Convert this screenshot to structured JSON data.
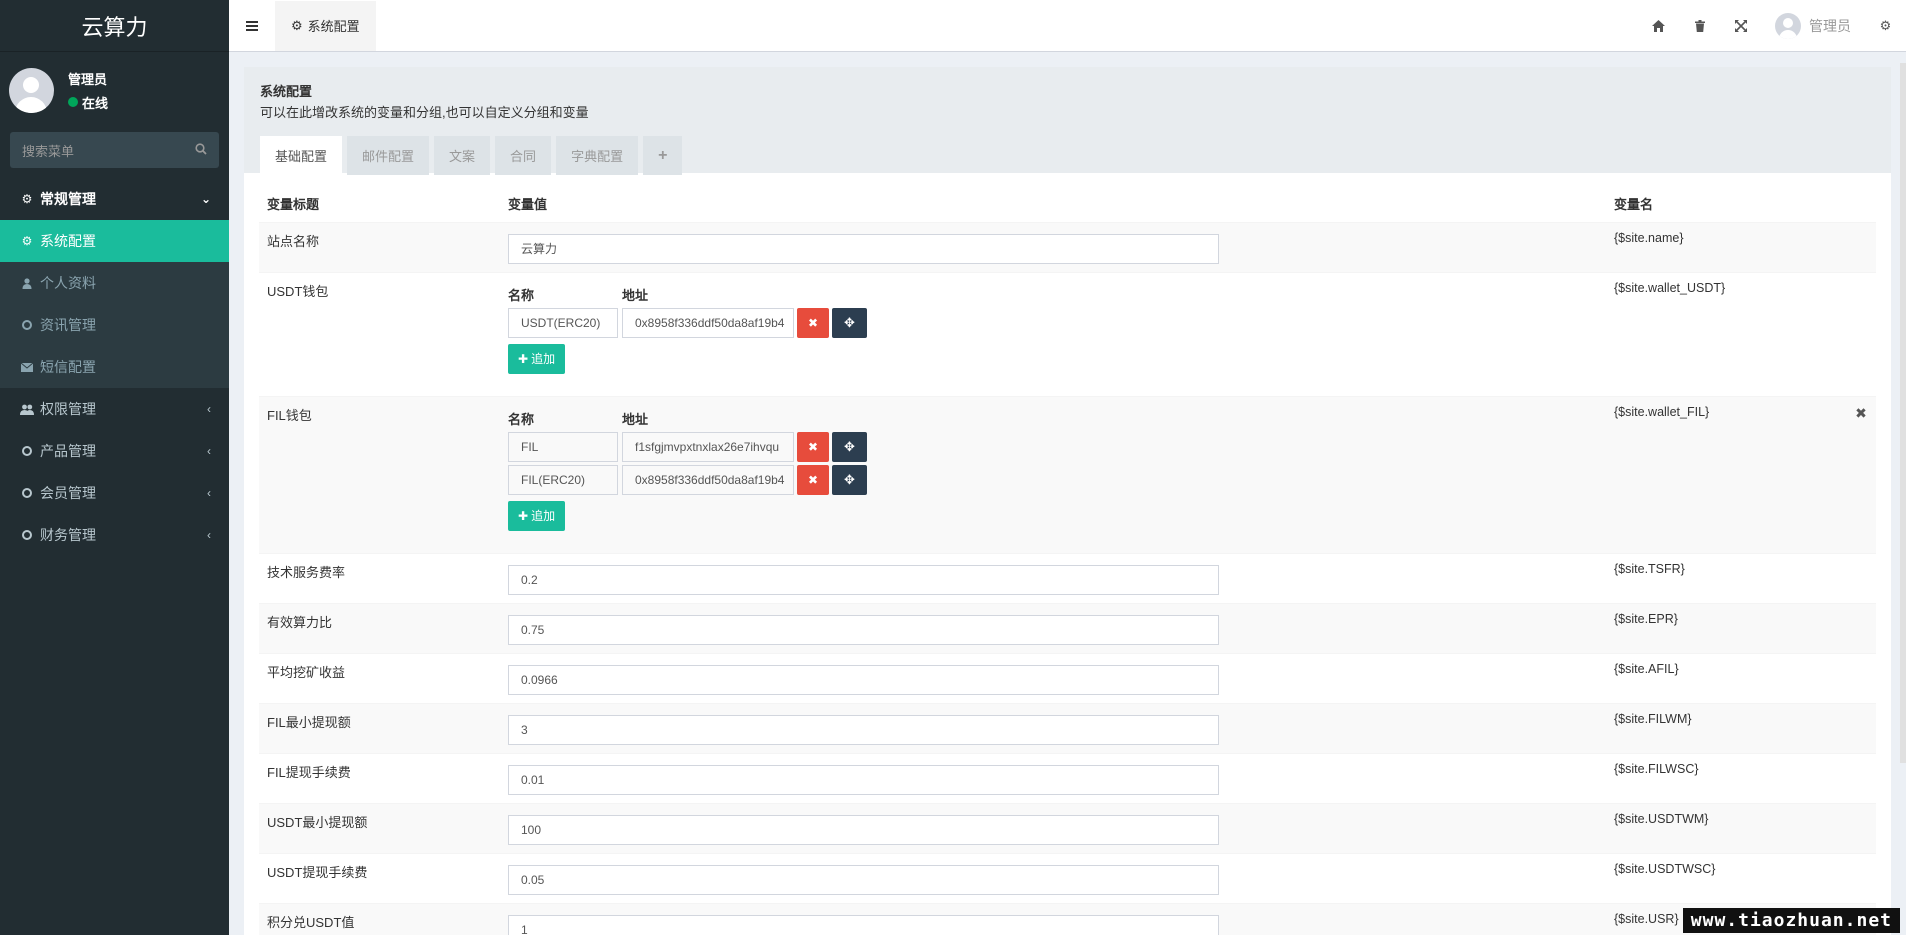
{
  "app": {
    "logo": "云算力"
  },
  "user": {
    "name": "管理员",
    "status": "在线"
  },
  "sidebar": {
    "search_placeholder": "搜索菜单",
    "items": [
      {
        "label": "常规管理",
        "icon": "cogs-icon"
      },
      {
        "label": "系统配置",
        "icon": "gear-icon"
      },
      {
        "label": "个人资料",
        "icon": "user-icon"
      },
      {
        "label": "资讯管理",
        "icon": "circle-icon"
      },
      {
        "label": "短信配置",
        "icon": "envelope-icon"
      },
      {
        "label": "权限管理",
        "icon": "users-icon"
      },
      {
        "label": "产品管理",
        "icon": "circle-icon"
      },
      {
        "label": "会员管理",
        "icon": "circle-icon"
      },
      {
        "label": "财务管理",
        "icon": "circle-icon"
      }
    ]
  },
  "topbar": {
    "tab_label": "系统配置",
    "user_name": "管理员"
  },
  "panel": {
    "title": "系统配置",
    "description": "可以在此增改系统的变量和分组,也可以自定义分组和变量",
    "tabs": [
      "基础配置",
      "邮件配置",
      "文案",
      "合同",
      "字典配置",
      "+"
    ]
  },
  "table": {
    "headers": [
      "变量标题",
      "变量值",
      "变量名"
    ],
    "site_name": {
      "title": "站点名称",
      "value": "云算力",
      "var": "{$site.name}"
    },
    "usdt": {
      "title": "USDT钱包",
      "col_name": "名称",
      "col_addr": "地址",
      "rows": [
        {
          "name": "USDT(ERC20)",
          "addr": "0x8958f336ddf50da8af19b4"
        }
      ],
      "add_label": "追加",
      "var": "{$site.wallet_USDT}"
    },
    "fil": {
      "title": "FIL钱包",
      "col_name": "名称",
      "col_addr": "地址",
      "rows": [
        {
          "name": "FIL",
          "addr": "f1sfgjmvpxtnxlax26e7ihvqu"
        },
        {
          "name": "FIL(ERC20)",
          "addr": "0x8958f336ddf50da8af19b4"
        }
      ],
      "add_label": "追加",
      "var": "{$site.wallet_FIL}"
    },
    "rows": [
      {
        "title": "技术服务费率",
        "value": "0.2",
        "var": "{$site.TSFR}"
      },
      {
        "title": "有效算力比",
        "value": "0.75",
        "var": "{$site.EPR}"
      },
      {
        "title": "平均挖矿收益",
        "value": "0.0966",
        "var": "{$site.AFIL}"
      },
      {
        "title": "FIL最小提现额",
        "value": "3",
        "var": "{$site.FILWM}"
      },
      {
        "title": "FIL提现手续费",
        "value": "0.01",
        "var": "{$site.FILWSC}"
      },
      {
        "title": "USDT最小提现额",
        "value": "100",
        "var": "{$site.USDTWM}"
      },
      {
        "title": "USDT提现手续费",
        "value": "0.05",
        "var": "{$site.USDTWSC}"
      },
      {
        "title": "积分兑USDT值",
        "value": "1",
        "var": "{$site.USR}"
      }
    ]
  },
  "watermark": "www.tiaozhuan.net"
}
